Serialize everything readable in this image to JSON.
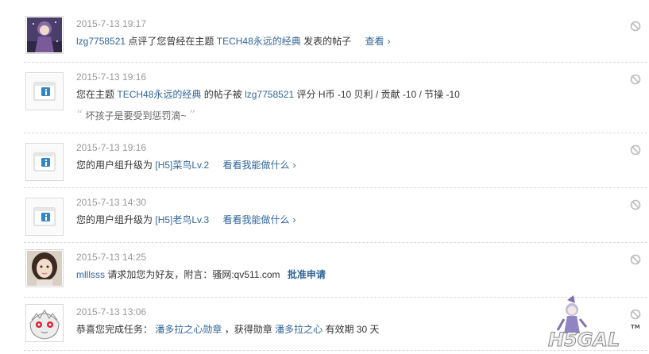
{
  "notices": [
    {
      "avatar": "anime-girl-avatar",
      "time": "2015-7-13 19:17",
      "user": "lzg7758521",
      "text1": "点评了您曾经在主题",
      "thread": "TECH48永远的经典",
      "text2": "发表的帖子",
      "action": "查看",
      "chevron": "›"
    },
    {
      "avatar": "system-info-icon",
      "time": "2015-7-13 19:16",
      "text1": "您在主题",
      "thread": "TECH48永远的经典",
      "text2": "的帖子被",
      "user": "lzg7758521",
      "text3": "评分 H币 -10 贝利 / 贡献 -10 / 节操 -10",
      "quote_open": "“",
      "quote": "坏孩子是要受到惩罚滴~",
      "quote_close": "”"
    },
    {
      "avatar": "system-info-icon",
      "time": "2015-7-13 19:16",
      "text1": "您的用户组升级为",
      "group": "[H5]菜鸟Lv.2",
      "action": "看看我能做什么",
      "chevron": "›"
    },
    {
      "avatar": "system-info-icon",
      "time": "2015-7-13 14:30",
      "text1": "您的用户组升级为",
      "group": "[H5]老鸟Lv.3",
      "action": "看看我能做什么",
      "chevron": "›"
    },
    {
      "avatar": "girl-photo-avatar",
      "time": "2015-7-13 14:25",
      "user": "mlllsss",
      "text1": "请求加您为好友，附言：骚网:qv511.com",
      "action": "批准申请"
    },
    {
      "avatar": "cartoon-avatar",
      "time": "2015-7-13 13:06",
      "text1": "恭喜您完成任务：",
      "task": "潘多拉之心勋章",
      "text2": "，获得勋章",
      "medal": "潘多拉之心",
      "text3": "有效期 30 天"
    }
  ],
  "logo": {
    "text": "H5GAL",
    "tm": "TM"
  },
  "colors": {
    "link": "#336699",
    "time": "#999999",
    "divider": "#d8d8d8",
    "info": "#2f86c9"
  }
}
